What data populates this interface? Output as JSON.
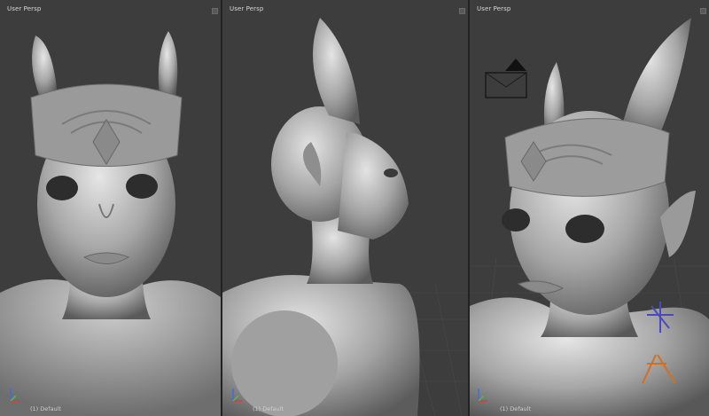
{
  "viewports": [
    {
      "title": "User Persp",
      "footer": "(1) Default"
    },
    {
      "title": "User Persp",
      "footer": "(1) Default"
    },
    {
      "title": "User Persp",
      "footer": "(1) Default"
    }
  ],
  "colors": {
    "viewport_bg": "#3d3d3d",
    "model_base": "#a9a9a9",
    "model_highlight": "#e8e8e8",
    "model_shadow": "#555555"
  }
}
